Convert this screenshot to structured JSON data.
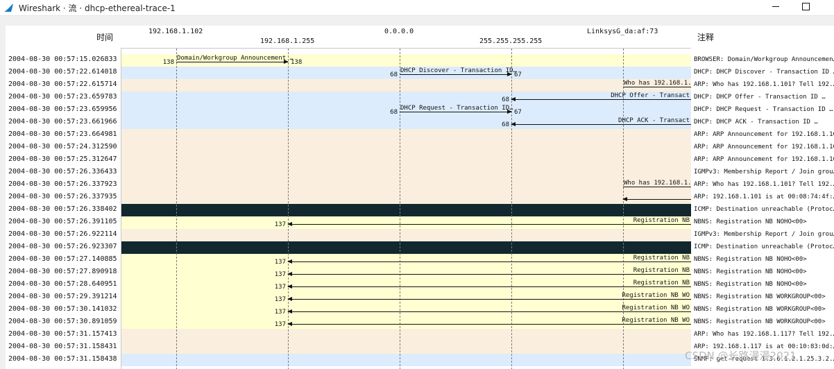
{
  "window": {
    "title": "Wireshark · 流 · dhcp-ethereal-trace-1"
  },
  "columns": {
    "time": "时间",
    "comment": "注释"
  },
  "hosts": [
    {
      "label": "192.168.1.102"
    },
    {
      "label": "192.168.1.255"
    },
    {
      "label": "0.0.0.0"
    },
    {
      "label": "255.255.255.255"
    },
    {
      "label": "LinksysG_da:af:73"
    }
  ],
  "colors": {
    "yellow": "#ffffd2",
    "blue": "#dcecfd",
    "tan": "#faefde",
    "dark": "#12272e"
  },
  "rows": [
    {
      "time": "2004-08-30 00:57:15.026833",
      "comment": "BROWSER: Domain/Workgroup Announcemen…",
      "color": "yellow",
      "arrow": {
        "from": 0,
        "to": 1,
        "label": "Domain/Workgroup Announcement …",
        "src_port": "138",
        "dst_port": "138"
      }
    },
    {
      "time": "2004-08-30 00:57:22.614018",
      "comment": "DHCP: DHCP Discover - Transaction ID …",
      "color": "blue",
      "arrow": {
        "from": 2,
        "to": 3,
        "label": "DHCP Discover - Transaction ID…",
        "src_port": "68",
        "dst_port": "67"
      }
    },
    {
      "time": "2004-08-30 00:57:22.615714",
      "comment": "ARP: Who has 192.168.1.101? Tell 192.…",
      "color": "tan",
      "arrow": {
        "from": 4,
        "to": 5,
        "label": "Who has 192.168.1.1",
        "src_port": "",
        "dst_port": ""
      }
    },
    {
      "time": "2004-08-30 00:57:23.659783",
      "comment": "DHCP: DHCP Offer    - Transaction ID …",
      "color": "blue",
      "arrow": {
        "from": 5,
        "to": 3,
        "label": "DHCP Offer    - Transact",
        "src_port": "",
        "dst_port": "68"
      }
    },
    {
      "time": "2004-08-30 00:57:23.659956",
      "comment": "DHCP: DHCP Request  - Transaction ID …",
      "color": "blue",
      "arrow": {
        "from": 2,
        "to": 3,
        "label": "DHCP Request  - Transaction ID…",
        "src_port": "68",
        "dst_port": "67"
      }
    },
    {
      "time": "2004-08-30 00:57:23.661966",
      "comment": "DHCP: DHCP ACK      - Transaction ID …",
      "color": "blue",
      "arrow": {
        "from": 5,
        "to": 3,
        "label": "DHCP ACK      - Transact",
        "src_port": "",
        "dst_port": "68"
      }
    },
    {
      "time": "2004-08-30 00:57:23.664981",
      "comment": "ARP: ARP Announcement for 192.168.1.101",
      "color": "tan"
    },
    {
      "time": "2004-08-30 00:57:24.312590",
      "comment": "ARP: ARP Announcement for 192.168.1.101",
      "color": "tan"
    },
    {
      "time": "2004-08-30 00:57:25.312647",
      "comment": "ARP: ARP Announcement for 192.168.1.101",
      "color": "tan"
    },
    {
      "time": "2004-08-30 00:57:26.336433",
      "comment": "IGMPv3: Membership Report / Join grou…",
      "color": "tan"
    },
    {
      "time": "2004-08-30 00:57:26.337923",
      "comment": "ARP: Who has 192.168.1.101? Tell 192.…",
      "color": "tan",
      "arrow": {
        "from": 4,
        "to": 5,
        "label": "Who has 192.168.1.1",
        "src_port": "",
        "dst_port": ""
      }
    },
    {
      "time": "2004-08-30 00:57:26.337935",
      "comment": "ARP: 192.168.1.101 is at 00:08:74:4f:…",
      "color": "tan",
      "arrow": {
        "from": 5,
        "to": 4,
        "label": "",
        "src_port": "",
        "dst_port": ""
      }
    },
    {
      "time": "2004-08-30 00:57:26.338402",
      "comment": "ICMP: Destination unreachable (Protoc…",
      "color": "dark"
    },
    {
      "time": "2004-08-30 00:57:26.391105",
      "comment": "NBNS: Registration NB NOHO<00>",
      "color": "yellow",
      "arrow": {
        "from": 5,
        "to": 1,
        "label": "Registration NB",
        "src_port": "",
        "dst_port": "137"
      }
    },
    {
      "time": "2004-08-30 00:57:26.922114",
      "comment": "IGMPv3: Membership Report / Join grou…",
      "color": "tan"
    },
    {
      "time": "2004-08-30 00:57:26.923307",
      "comment": "ICMP: Destination unreachable (Protoc…",
      "color": "dark"
    },
    {
      "time": "2004-08-30 00:57:27.140885",
      "comment": "NBNS: Registration NB NOHO<00>",
      "color": "yellow",
      "arrow": {
        "from": 5,
        "to": 1,
        "label": "Registration NB",
        "src_port": "",
        "dst_port": "137"
      }
    },
    {
      "time": "2004-08-30 00:57:27.890918",
      "comment": "NBNS: Registration NB NOHO<00>",
      "color": "yellow",
      "arrow": {
        "from": 5,
        "to": 1,
        "label": "Registration NB",
        "src_port": "",
        "dst_port": "137"
      }
    },
    {
      "time": "2004-08-30 00:57:28.640951",
      "comment": "NBNS: Registration NB NOHO<00>",
      "color": "yellow",
      "arrow": {
        "from": 5,
        "to": 1,
        "label": "Registration NB",
        "src_port": "",
        "dst_port": "137"
      }
    },
    {
      "time": "2004-08-30 00:57:29.391214",
      "comment": "NBNS: Registration NB WORKGROUP<00>",
      "color": "yellow",
      "arrow": {
        "from": 5,
        "to": 1,
        "label": "Registration NB WO",
        "src_port": "",
        "dst_port": "137"
      }
    },
    {
      "time": "2004-08-30 00:57:30.141032",
      "comment": "NBNS: Registration NB WORKGROUP<00>",
      "color": "yellow",
      "arrow": {
        "from": 5,
        "to": 1,
        "label": "Registration NB WO",
        "src_port": "",
        "dst_port": "137"
      }
    },
    {
      "time": "2004-08-30 00:57:30.891059",
      "comment": "NBNS: Registration NB WORKGROUP<00>",
      "color": "yellow",
      "arrow": {
        "from": 5,
        "to": 1,
        "label": "Registration NB WO",
        "src_port": "",
        "dst_port": "137"
      }
    },
    {
      "time": "2004-08-30 00:57:31.157413",
      "comment": "ARP: Who has 192.168.1.117? Tell 192.…",
      "color": "tan"
    },
    {
      "time": "2004-08-30 00:57:31.158431",
      "comment": "ARP: 192.168.1.117 is at 00:10:83:0d:…",
      "color": "tan"
    },
    {
      "time": "2004-08-30 00:57:31.158438",
      "comment": "SNMP: get-request 1.3.6.1.2.1.25.3.2.…",
      "color": "blue"
    }
  ],
  "watermark": "CSDN @长路漫漫2021"
}
